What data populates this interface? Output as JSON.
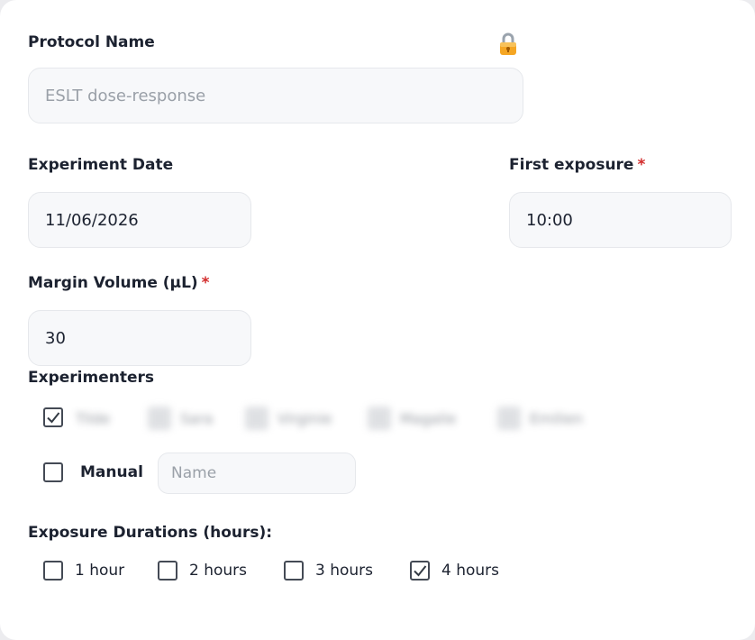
{
  "protocol": {
    "label": "Protocol Name",
    "placeholder": "ESLT dose-response",
    "lock_icon": "lock-icon"
  },
  "experiment_date": {
    "label": "Experiment Date",
    "value": "11/06/2026"
  },
  "first_exposure": {
    "label": "First exposure",
    "required_mark": "*",
    "value": "10:00"
  },
  "margin_volume": {
    "label": "Margin Volume (µL)",
    "required_mark": "*",
    "value": "30"
  },
  "experimenters": {
    "label": "Experimenters",
    "list": [
      {
        "name": "Tilde",
        "checked": true
      },
      {
        "name": "Sara",
        "checked": false
      },
      {
        "name": "Virginie",
        "checked": false
      },
      {
        "name": "Magalie",
        "checked": false
      },
      {
        "name": "Emilien",
        "checked": false
      }
    ],
    "manual_label": "Manual",
    "manual_checked": false,
    "name_placeholder": "Name"
  },
  "durations": {
    "label": "Exposure Durations (hours):",
    "options": [
      {
        "label": "1 hour",
        "checked": false
      },
      {
        "label": "2 hours",
        "checked": false
      },
      {
        "label": "3 hours",
        "checked": false
      },
      {
        "label": "4 hours",
        "checked": true
      }
    ]
  },
  "colors": {
    "required": "#d22b2b",
    "input_bg": "#f7f8fa",
    "text": "#1c2230"
  }
}
